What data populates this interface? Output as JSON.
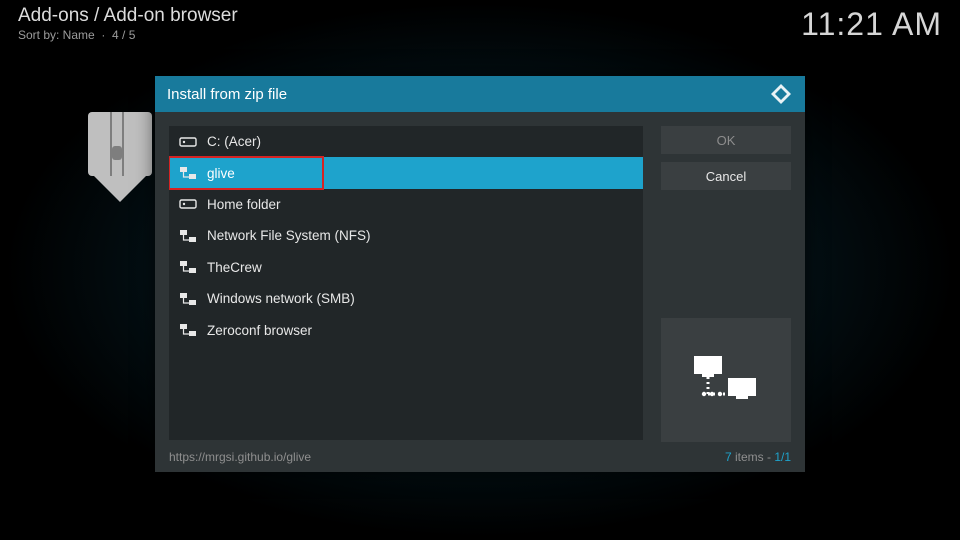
{
  "header": {
    "breadcrumb": "Add-ons / Add-on browser",
    "sort_label": "Sort by: Name",
    "page_index": "4 / 5",
    "clock": "11:21 AM"
  },
  "dialog": {
    "title": "Install from zip file",
    "items": [
      {
        "label": "C: (Acer)",
        "icon": "hdd",
        "selected": false
      },
      {
        "label": "glive",
        "icon": "network",
        "selected": true
      },
      {
        "label": "Home folder",
        "icon": "hdd",
        "selected": false
      },
      {
        "label": "Network File System (NFS)",
        "icon": "network",
        "selected": false
      },
      {
        "label": "TheCrew",
        "icon": "network",
        "selected": false
      },
      {
        "label": "Windows network (SMB)",
        "icon": "network",
        "selected": false
      },
      {
        "label": "Zeroconf browser",
        "icon": "network",
        "selected": false
      }
    ],
    "ok_label": "OK",
    "cancel_label": "Cancel",
    "path": "https://mrgsi.github.io/glive",
    "count_num": "7",
    "count_word": " items - ",
    "count_page": "1/1"
  },
  "annotation": {
    "highlight_index": 1
  }
}
